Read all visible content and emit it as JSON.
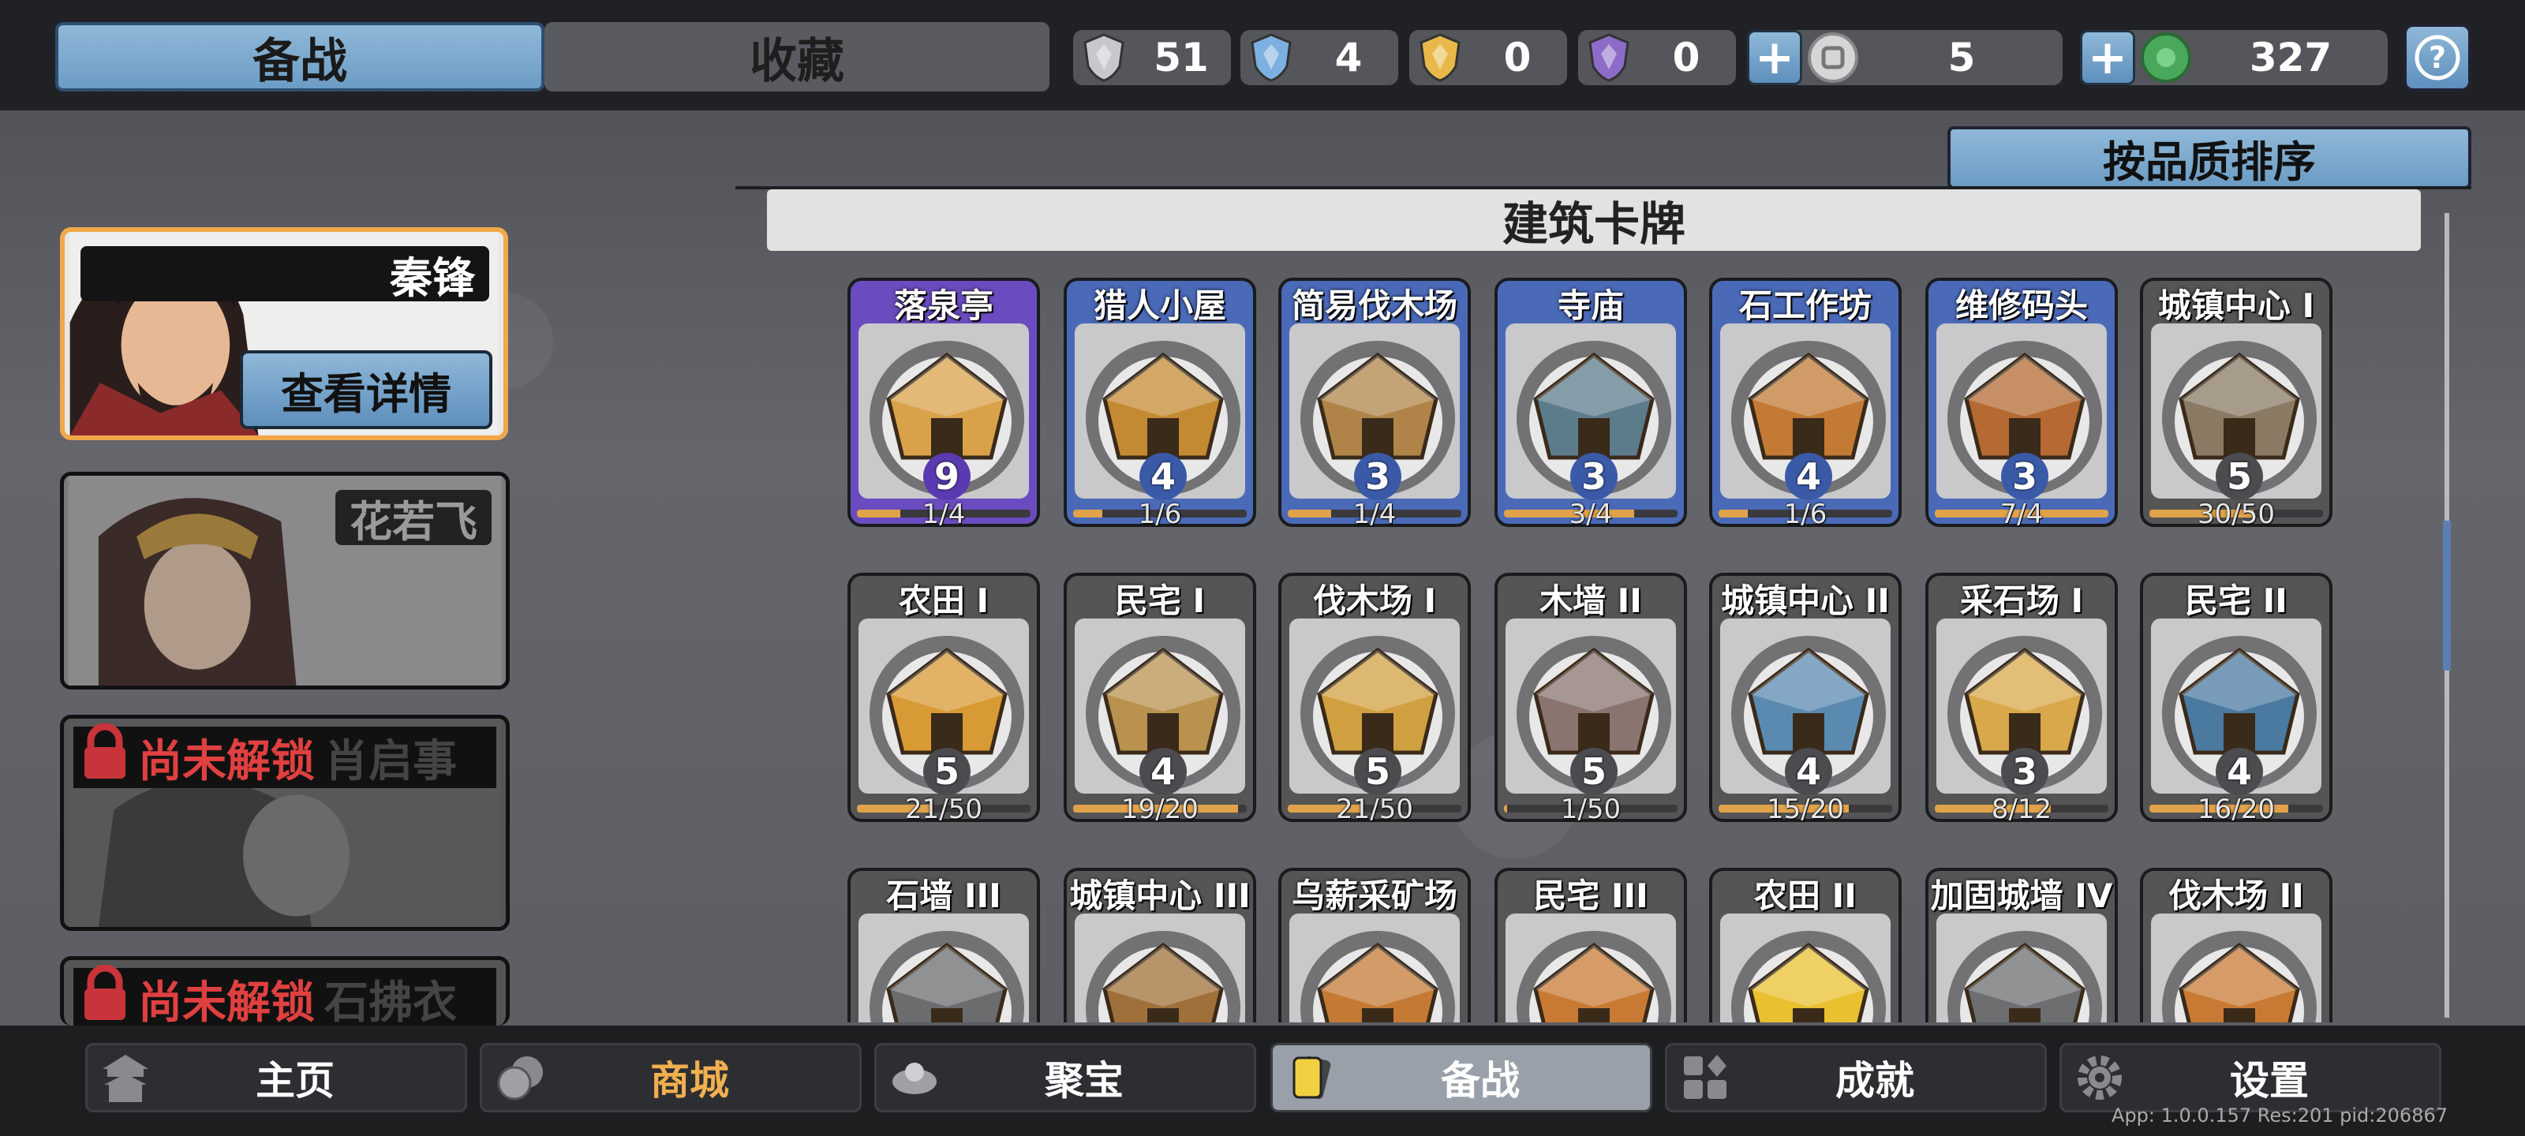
{
  "tabs": {
    "active": "备战",
    "other": "收藏"
  },
  "resources": [
    {
      "icon": "silver-shield-icon",
      "value": "51",
      "color": "#c8c8cc"
    },
    {
      "icon": "blue-shield-icon",
      "value": "4",
      "color": "#7cb0e0"
    },
    {
      "icon": "gold-shield-icon",
      "value": "0",
      "color": "#e8b84a"
    },
    {
      "icon": "purple-shield-icon",
      "value": "0",
      "color": "#8c6cc8"
    }
  ],
  "currencies": [
    {
      "icon": "coin-icon",
      "value": "5",
      "color": "#c9c9cc"
    },
    {
      "icon": "jade-icon",
      "value": "327",
      "color": "#4aa85a"
    }
  ],
  "sort_label": "按品质排序",
  "section_title": "建筑卡牌",
  "heroes": [
    {
      "name": "秦锋",
      "detail_label": "查看详情",
      "selected": true
    },
    {
      "name": "花若飞",
      "selected": false
    },
    {
      "name": "肖启事",
      "lock_label": "尚未解锁",
      "locked": true
    },
    {
      "name": "石拂衣",
      "lock_label": "尚未解锁",
      "locked": true
    }
  ],
  "cards": [
    {
      "name": "落泉亭",
      "level": "9",
      "progress": "1/4",
      "fill": 0.25,
      "rarity": "#6a4cc0",
      "art": "#d9a24a"
    },
    {
      "name": "猎人小屋",
      "level": "4",
      "progress": "1/6",
      "fill": 0.17,
      "rarity": "#4a6ab8",
      "art": "#c48a32"
    },
    {
      "name": "简易伐木场",
      "level": "3",
      "progress": "1/4",
      "fill": 0.25,
      "rarity": "#4a6ab8",
      "art": "#b08448"
    },
    {
      "name": "寺庙",
      "level": "3",
      "progress": "3/4",
      "fill": 0.75,
      "rarity": "#4a6ab8",
      "art": "#5c7c8c"
    },
    {
      "name": "石工作坊",
      "level": "4",
      "progress": "1/6",
      "fill": 0.17,
      "rarity": "#4a6ab8",
      "art": "#c27a34"
    },
    {
      "name": "维修码头",
      "level": "3",
      "progress": "7/4",
      "fill": 1.0,
      "rarity": "#4a6ab8",
      "art": "#b46a32"
    },
    {
      "name": "城镇中心 I",
      "level": "5",
      "progress": "30/50",
      "fill": 0.6,
      "rarity": "#555",
      "art": "#8a7a64"
    },
    {
      "name": "农田 I",
      "level": "5",
      "progress": "21/50",
      "fill": 0.42,
      "rarity": "#555",
      "art": "#d89a34"
    },
    {
      "name": "民宅 I",
      "level": "4",
      "progress": "19/20",
      "fill": 0.95,
      "rarity": "#555",
      "art": "#b8924e"
    },
    {
      "name": "伐木场 I",
      "level": "5",
      "progress": "21/50",
      "fill": 0.42,
      "rarity": "#555",
      "art": "#d0a040"
    },
    {
      "name": "木墙 II",
      "level": "5",
      "progress": "1/50",
      "fill": 0.02,
      "rarity": "#555",
      "art": "#8a7470"
    },
    {
      "name": "城镇中心 II",
      "level": "4",
      "progress": "15/20",
      "fill": 0.75,
      "rarity": "#555",
      "art": "#5a8ab0"
    },
    {
      "name": "采石场 I",
      "level": "3",
      "progress": "8/12",
      "fill": 0.67,
      "rarity": "#555",
      "art": "#d8a84a"
    },
    {
      "name": "民宅 II",
      "level": "4",
      "progress": "16/20",
      "fill": 0.8,
      "rarity": "#555",
      "art": "#4a7aa0"
    },
    {
      "name": "石墙 III",
      "level": "",
      "progress": "",
      "fill": 0,
      "rarity": "#555",
      "art": "#6a6c6e"
    },
    {
      "name": "城镇中心 III",
      "level": "",
      "progress": "",
      "fill": 0,
      "rarity": "#555",
      "art": "#a0703a"
    },
    {
      "name": "乌薪采矿场",
      "level": "",
      "progress": "",
      "fill": 0,
      "rarity": "#555",
      "art": "#c47a34"
    },
    {
      "name": "民宅 III",
      "level": "",
      "progress": "",
      "fill": 0,
      "rarity": "#555",
      "art": "#c87a34"
    },
    {
      "name": "农田 II",
      "level": "",
      "progress": "",
      "fill": 0,
      "rarity": "#555",
      "art": "#e8c030"
    },
    {
      "name": "加固城墙 IV",
      "level": "",
      "progress": "",
      "fill": 0,
      "rarity": "#555",
      "art": "#6c6e70"
    },
    {
      "name": "伐木场 II",
      "level": "",
      "progress": "",
      "fill": 0,
      "rarity": "#555",
      "art": "#c87a34"
    }
  ],
  "nav": [
    {
      "label": "主页",
      "icon": "home-pagoda-icon",
      "active": false,
      "color": "#ffffff"
    },
    {
      "label": "商城",
      "icon": "shop-coins-icon",
      "active": false,
      "color": "#f0b050"
    },
    {
      "label": "聚宝",
      "icon": "treasure-bowl-icon",
      "active": false,
      "color": "#ffffff"
    },
    {
      "label": "备战",
      "icon": "card-deck-icon",
      "active": true,
      "color": "#ffffff"
    },
    {
      "label": "成就",
      "icon": "achievement-grid-icon",
      "active": false,
      "color": "#ffffff"
    },
    {
      "label": "设置",
      "icon": "gear-icon",
      "active": false,
      "color": "#ffffff"
    }
  ],
  "version": "App: 1.0.0.157 Res:201 pid:206867"
}
